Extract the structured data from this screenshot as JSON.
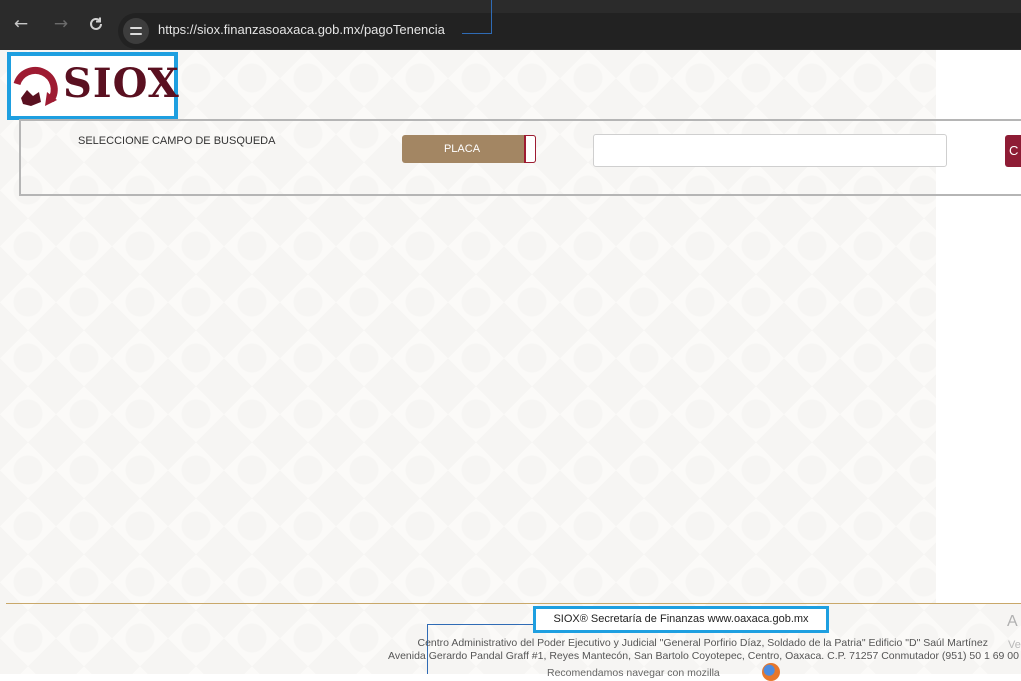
{
  "browser": {
    "back_icon": "←",
    "forward_icon": "→",
    "reload_icon": "C",
    "url": "https://siox.finanzasoaxaca.gob.mx/pagoTenencia"
  },
  "logo": {
    "text": "SIOX",
    "brand_color": "#5a1020",
    "accent_color": "#9e1b32"
  },
  "search": {
    "label": "SELECCIONE CAMPO DE BUSQUEDA",
    "field_value": "PLACA",
    "input_value": "",
    "button_label": "C"
  },
  "footer": {
    "copyright": "SIOX® Secretaría de Finanzas www.oaxaca.gob.mx",
    "line1": "Centro Administrativo del Poder Ejecutivo y Judicial \"General Porfirio Díaz, Soldado de la Patria\" Edificio \"D\" Saúl Martínez",
    "line2": "Avenida Gerardo Pandal Graff #1, Reyes Mantecón, San Bartolo Coyotepec, Centro, Oaxaca. C.P. 71257 Conmutador (951) 50 1 69 00",
    "line3": "Recomendamos navegar con mozilla",
    "side_a": "A",
    "side_ve": "Ve"
  }
}
